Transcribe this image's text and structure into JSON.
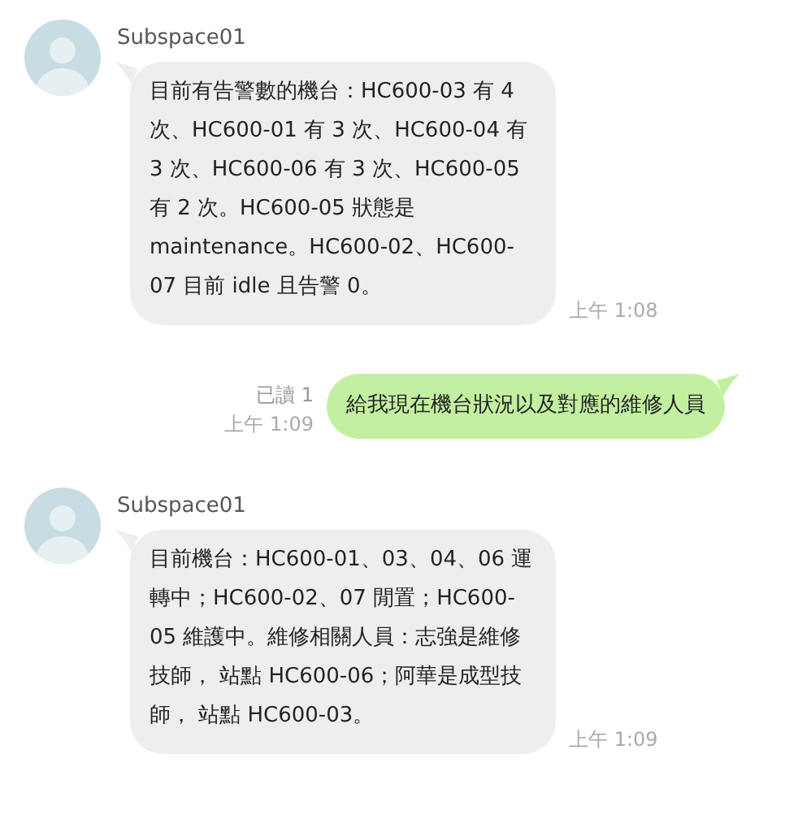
{
  "messages": [
    {
      "kind": "incoming",
      "sender": "Subspace01",
      "text": "目前有告警數的機台：HC600-03 有 4 次、HC600-01 有 3 次、HC600-04 有 3 次、HC600-06 有 3 次、HC600-05 有 2 次。HC600-05 狀態是 maintenance。HC600-02、HC600-07 目前 idle 且告警 0。",
      "time": "上午 1:08"
    },
    {
      "kind": "outgoing",
      "read": "已讀 1",
      "text": "給我現在機台狀況以及對應的維修人員",
      "time": "上午 1:09"
    },
    {
      "kind": "incoming",
      "sender": "Subspace01",
      "text": "目前機台：HC600-01、03、04、06 運轉中；HC600-02、07 閒置；HC600-05 維護中。維修相關人員：志強是維修技師， 站點 HC600-06；阿華是成型技師， 站點 HC600-03。",
      "time": "上午 1:09"
    }
  ]
}
